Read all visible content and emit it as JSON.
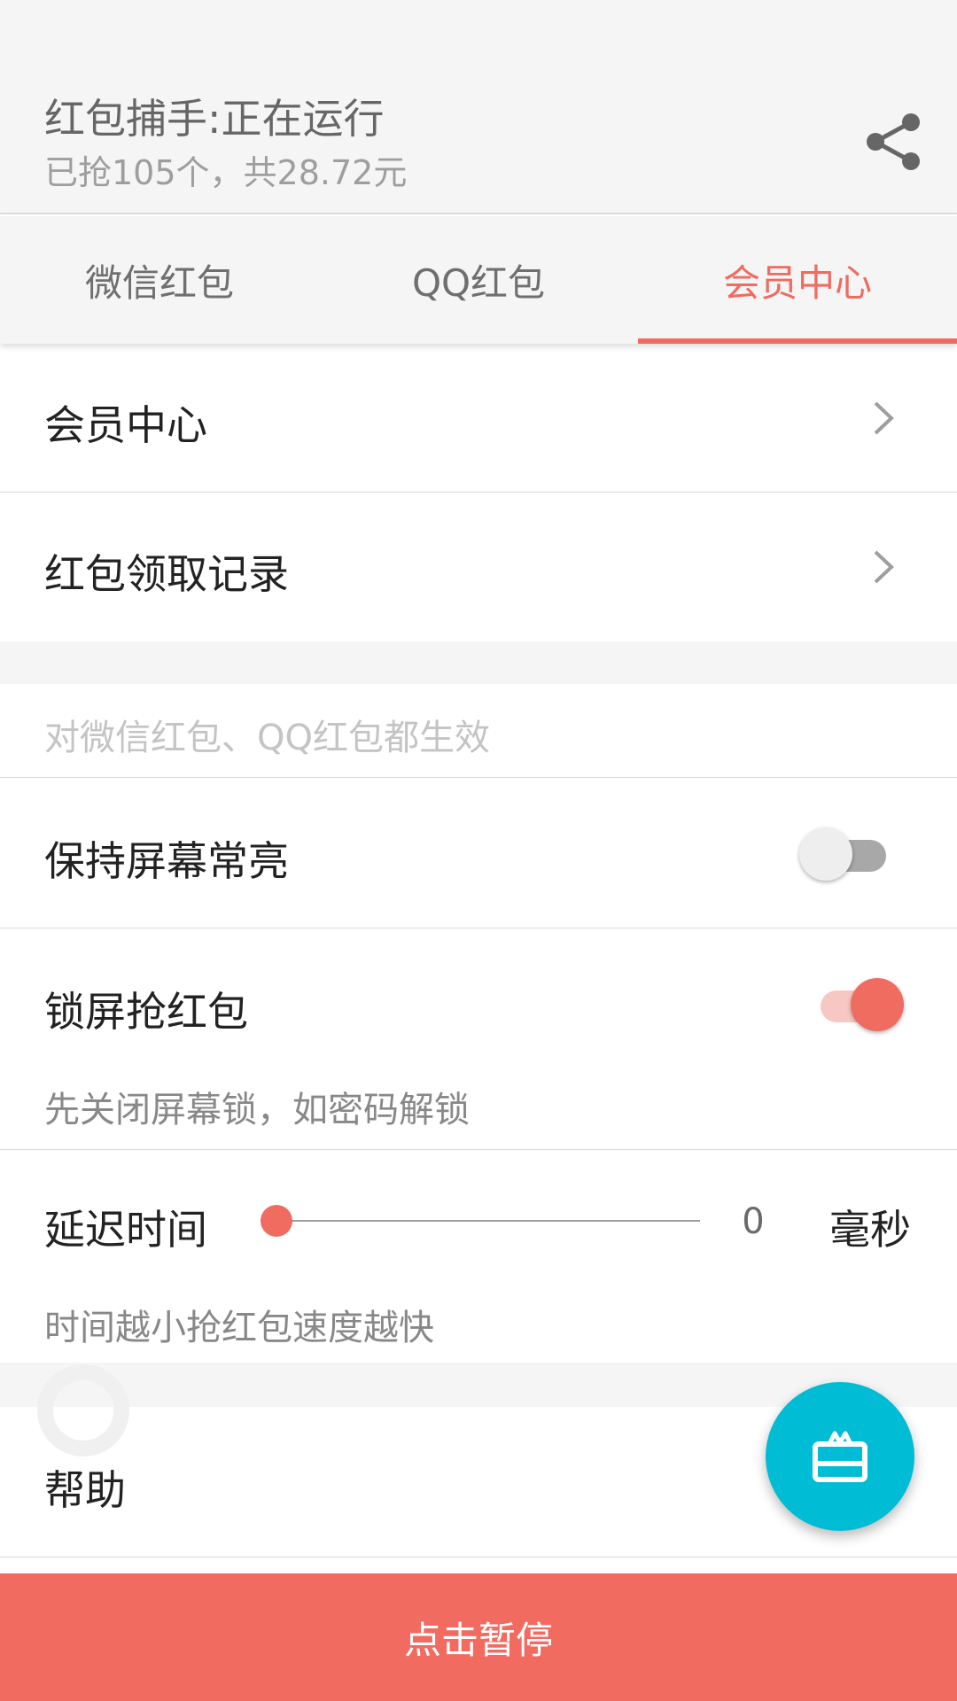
{
  "header": {
    "title": "红包捕手:正在运行",
    "subtitle": "已抢105个，共28.72元",
    "share_icon": "share-icon"
  },
  "tabs": [
    {
      "label": "微信红包",
      "active": false
    },
    {
      "label": "QQ红包",
      "active": false
    },
    {
      "label": "会员中心",
      "active": true
    }
  ],
  "menu": {
    "member_center": "会员中心",
    "records": "红包领取记录"
  },
  "settings": {
    "note": "对微信红包、QQ红包都生效",
    "keep_screen_on": {
      "label": "保持屏幕常亮",
      "enabled": false
    },
    "lock_screen": {
      "label": "锁屏抢红包",
      "enabled": true,
      "hint": "先关闭屏幕锁，如密码解锁"
    },
    "delay": {
      "label": "延迟时间",
      "value": "0",
      "unit": "毫秒",
      "hint": "时间越小抢红包速度越快"
    }
  },
  "help": {
    "label": "帮助"
  },
  "fab": {
    "icon": "gift-card-icon"
  },
  "bottom_button": {
    "label": "点击暂停"
  },
  "colors": {
    "accent": "#f06b60",
    "fab": "#00bcd4",
    "bottom": "#f26b61"
  }
}
